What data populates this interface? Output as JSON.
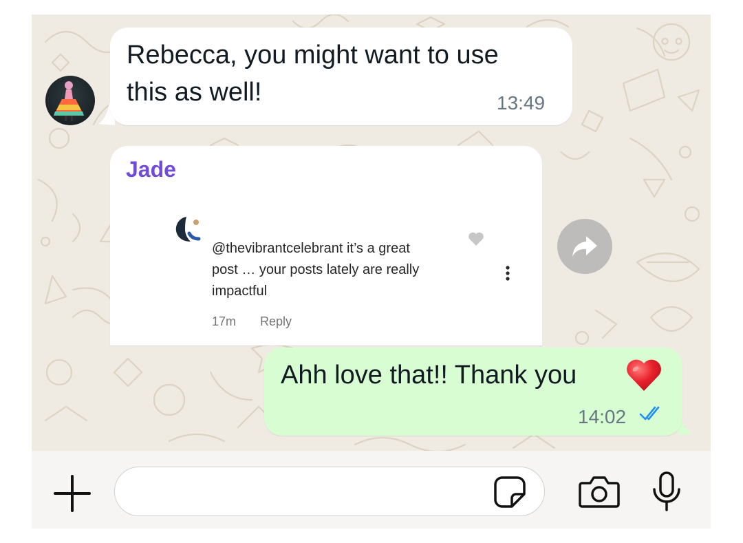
{
  "incoming_message": {
    "text_line1": "Rebecca, you might want to use",
    "text_line2": "this as well!",
    "time": "13:49"
  },
  "embedded_post": {
    "sender_name": "Jade",
    "comment_line1": "@thevibrantcelebrant it’s a great",
    "comment_line2": "post … your posts lately are really",
    "comment_line3": "impactful",
    "age": "17m",
    "reply_label": "Reply"
  },
  "outgoing_message": {
    "text": "Ahh love that!! Thank you",
    "emoji": "heart-emoji",
    "time": "14:02",
    "status": "read"
  },
  "composer": {
    "input_value": "",
    "icons": [
      "plus-icon",
      "sticker-icon",
      "camera-icon",
      "mic-icon"
    ]
  },
  "icons": [
    "forward-icon",
    "heart-icon",
    "more-vertical-icon",
    "double-check-icon"
  ],
  "colors": {
    "wallpaper": "#efeae2",
    "outgoing_bubble": "#d9fdd3",
    "sender_name": "#6f4bd8",
    "read_ticks": "#1e8ef5"
  }
}
